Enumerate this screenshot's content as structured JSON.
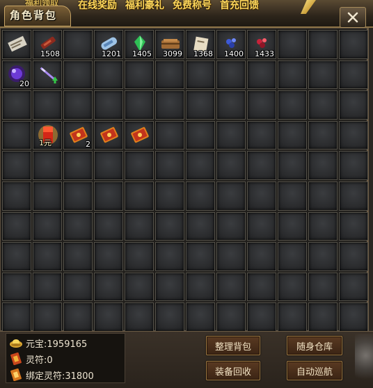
{
  "banner": {
    "cut_link": "福利领取",
    "links": [
      "在线奖励",
      "福利豪礼",
      "免费称号",
      "首充回馈"
    ]
  },
  "window": {
    "title": "角色背包",
    "close_icon": "close-icon"
  },
  "grid": {
    "columns": 12,
    "rows": 10,
    "items": [
      {
        "row": 0,
        "col": 0,
        "icon": "scroll-paper-icon",
        "qty": ""
      },
      {
        "row": 0,
        "col": 1,
        "icon": "red-tool-icon",
        "qty": "1508"
      },
      {
        "row": 0,
        "col": 3,
        "icon": "blue-scroll-icon",
        "qty": "1201"
      },
      {
        "row": 0,
        "col": 4,
        "icon": "green-gem-icon",
        "qty": "1405"
      },
      {
        "row": 0,
        "col": 5,
        "icon": "brown-bundle-icon",
        "qty": "3099"
      },
      {
        "row": 0,
        "col": 6,
        "icon": "parchment-icon",
        "qty": "1368"
      },
      {
        "row": 0,
        "col": 7,
        "icon": "blue-crystal-icon",
        "qty": "1400"
      },
      {
        "row": 0,
        "col": 8,
        "icon": "red-crystal-icon",
        "qty": "1433"
      },
      {
        "row": 1,
        "col": 0,
        "icon": "purple-orb-icon",
        "qty": "20"
      },
      {
        "row": 1,
        "col": 1,
        "icon": "purple-sword-upgrade-icon",
        "qty": ""
      },
      {
        "row": 3,
        "col": 1,
        "icon": "red-envelope-glowing-icon",
        "qty": "",
        "overlay": "1元"
      },
      {
        "row": 3,
        "col": 2,
        "icon": "red-envelope-icon",
        "qty": "2"
      },
      {
        "row": 3,
        "col": 3,
        "icon": "red-envelope-icon",
        "qty": ""
      },
      {
        "row": 3,
        "col": 4,
        "icon": "red-envelope-icon",
        "qty": ""
      }
    ]
  },
  "currency": {
    "yuanbao": "元宝:1959165",
    "lingfu": "灵符:0",
    "bound_lingfu": "绑定灵符:31800"
  },
  "buttons": {
    "sort": "整理背包",
    "storage": "随身仓库",
    "recycle": "装备回收",
    "patrol": "自动巡航"
  },
  "colors": {
    "banner_text": "#ffd75a",
    "button_bg": "#4a2e1a",
    "button_border": "#a07a44"
  }
}
